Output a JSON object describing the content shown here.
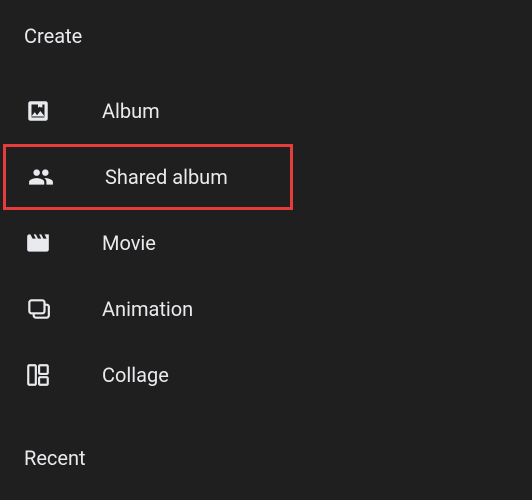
{
  "sections": {
    "create": {
      "heading": "Create",
      "items": [
        {
          "label": "Album",
          "icon": "album",
          "highlighted": false
        },
        {
          "label": "Shared album",
          "icon": "shared-album",
          "highlighted": true
        },
        {
          "label": "Movie",
          "icon": "movie",
          "highlighted": false
        },
        {
          "label": "Animation",
          "icon": "animation",
          "highlighted": false
        },
        {
          "label": "Collage",
          "icon": "collage",
          "highlighted": false
        }
      ]
    },
    "recent": {
      "heading": "Recent"
    }
  }
}
